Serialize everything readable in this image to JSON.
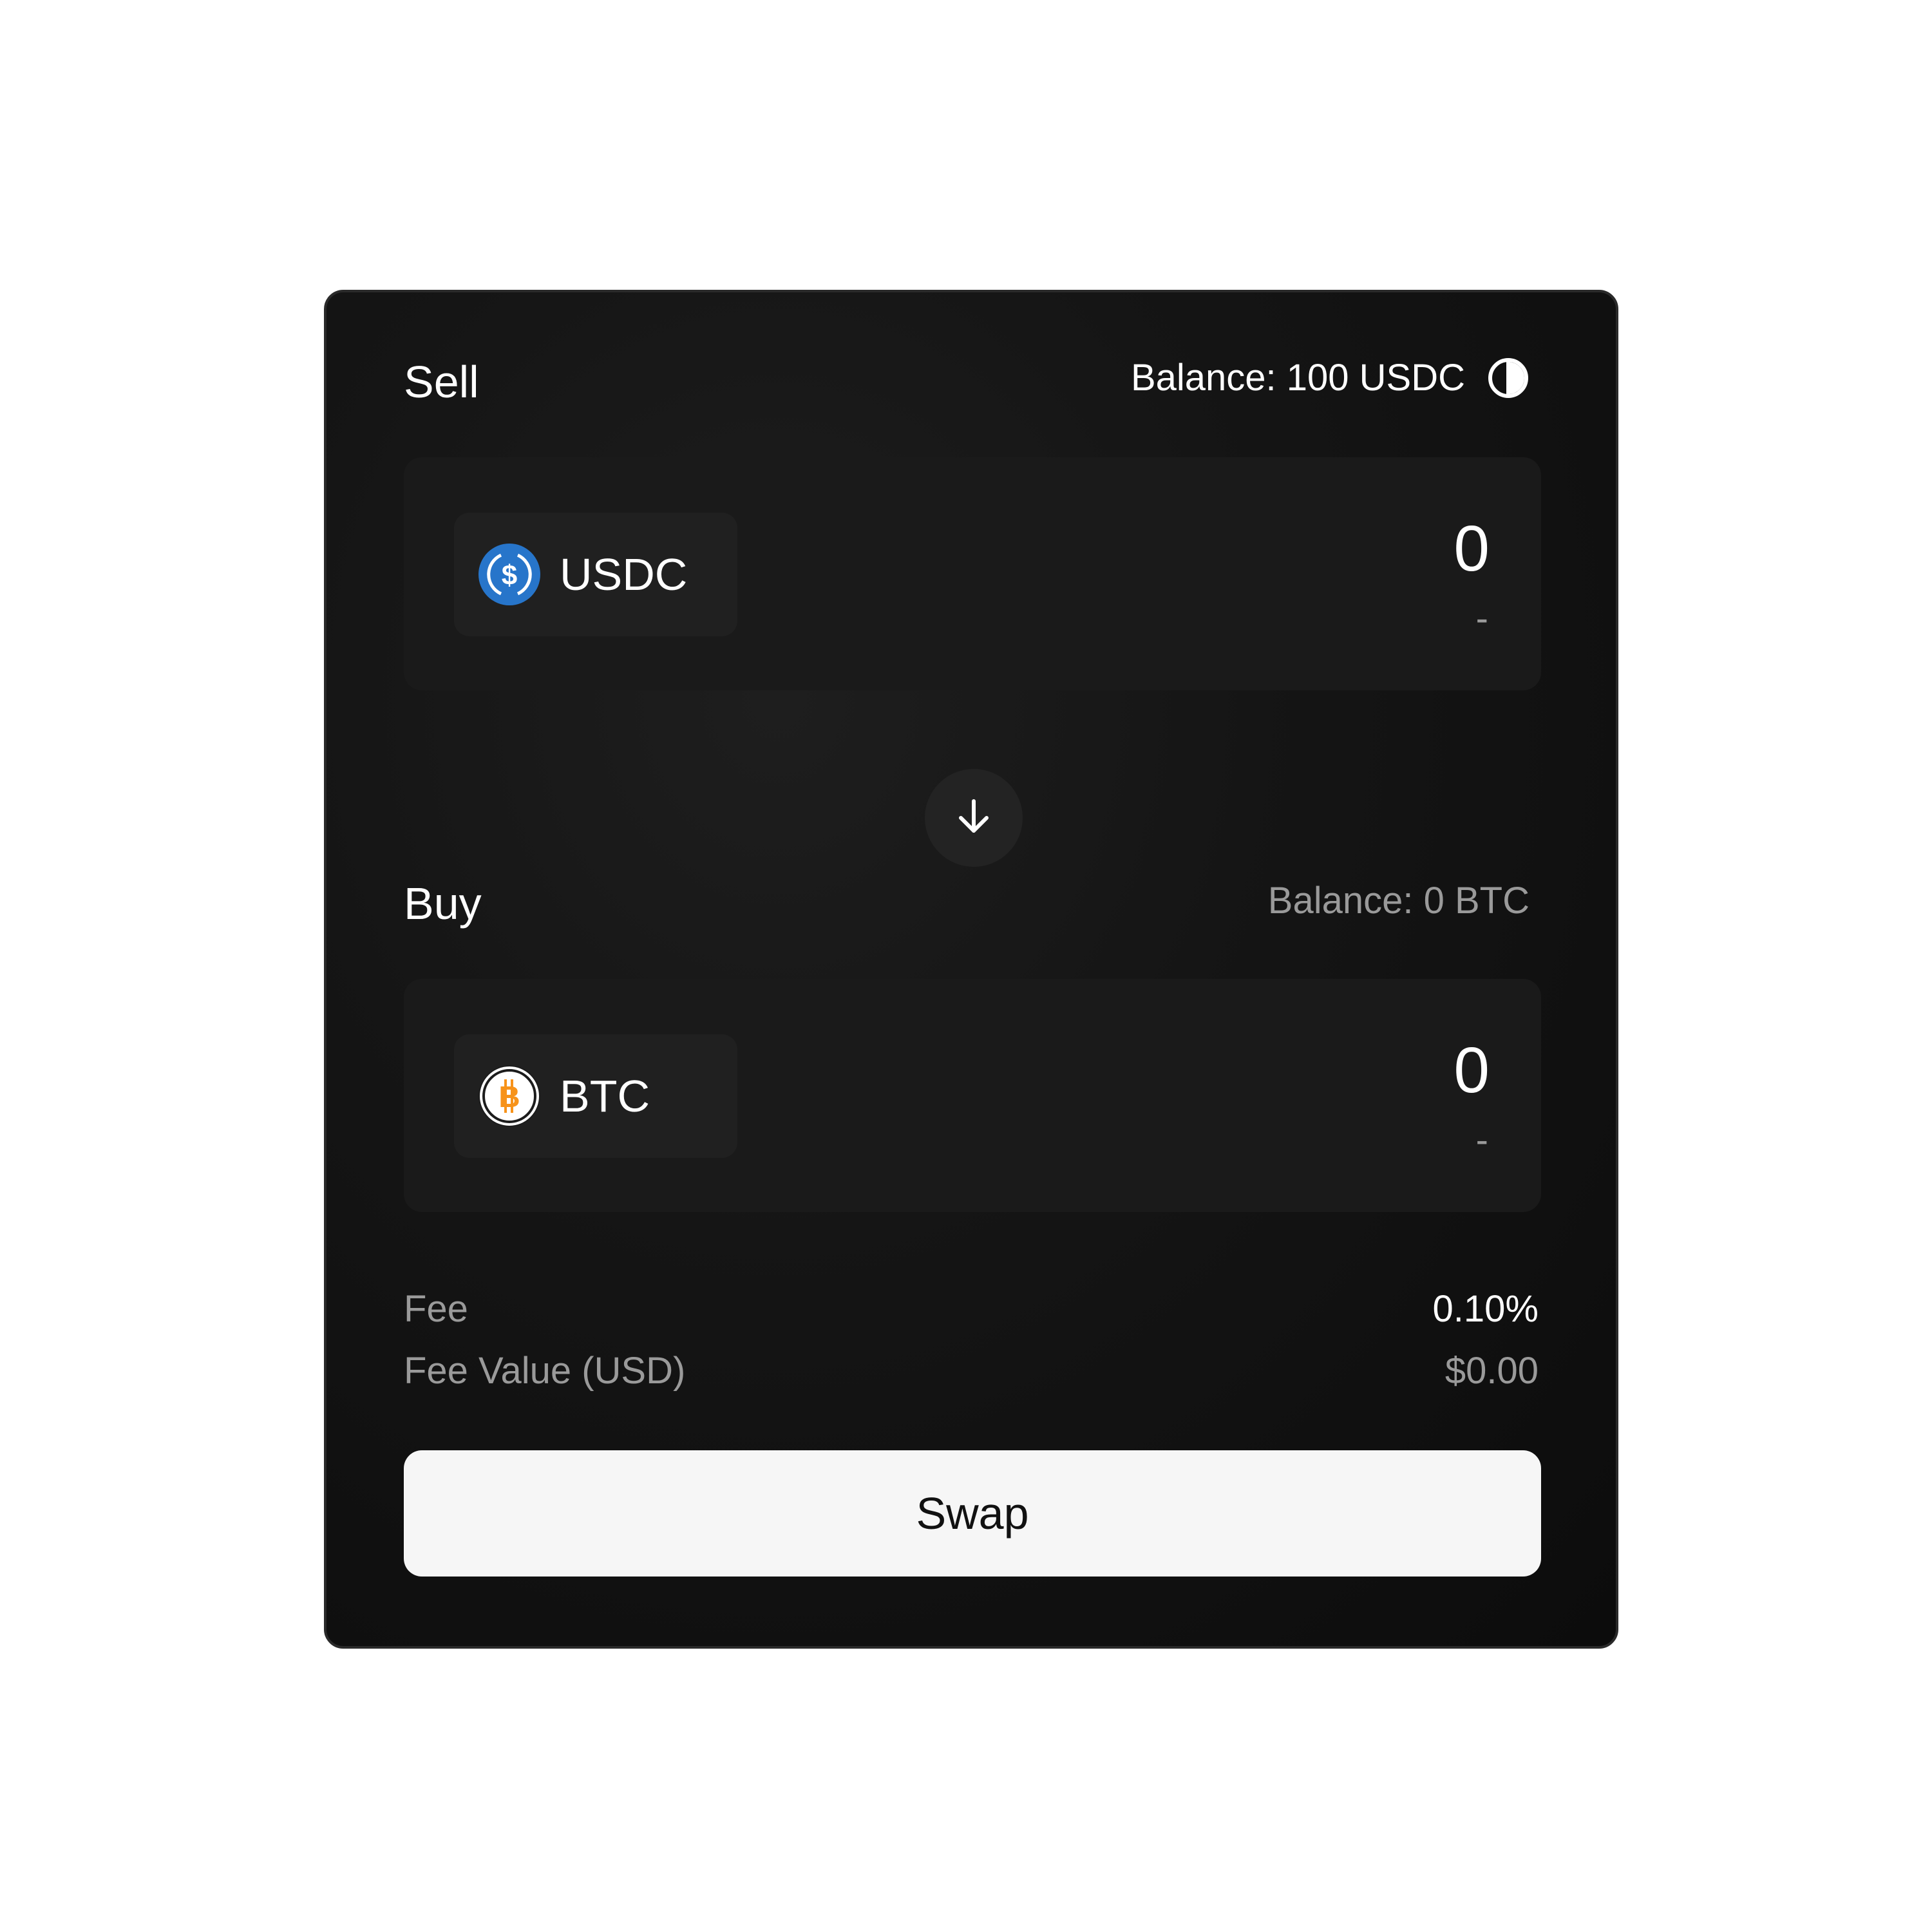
{
  "sell": {
    "label": "Sell",
    "balance": "Balance: 100 USDC",
    "max_icon": "max-icon",
    "token": {
      "symbol": "USDC",
      "icon": "usdc-icon",
      "color": "#2775CA"
    },
    "amount": "0",
    "amount_usd": "-"
  },
  "switch": {
    "icon": "arrow-down-icon"
  },
  "buy": {
    "label": "Buy",
    "balance": "Balance: 0 BTC",
    "token": {
      "symbol": "BTC",
      "icon": "btc-icon",
      "color": "#F7931A"
    },
    "amount": "0",
    "amount_usd": "-"
  },
  "fees": {
    "fee_label": "Fee",
    "fee_value": "0.10%",
    "fee_usd_label": "Fee Value (USD)",
    "fee_usd_value": "$0.00"
  },
  "swap_button": {
    "label": "Swap"
  },
  "colors": {
    "card_bg": "#111111",
    "panel_bg": "#1a1a1a",
    "button_bg": "#f6f6f6",
    "muted_text": "#9a9a9a"
  }
}
